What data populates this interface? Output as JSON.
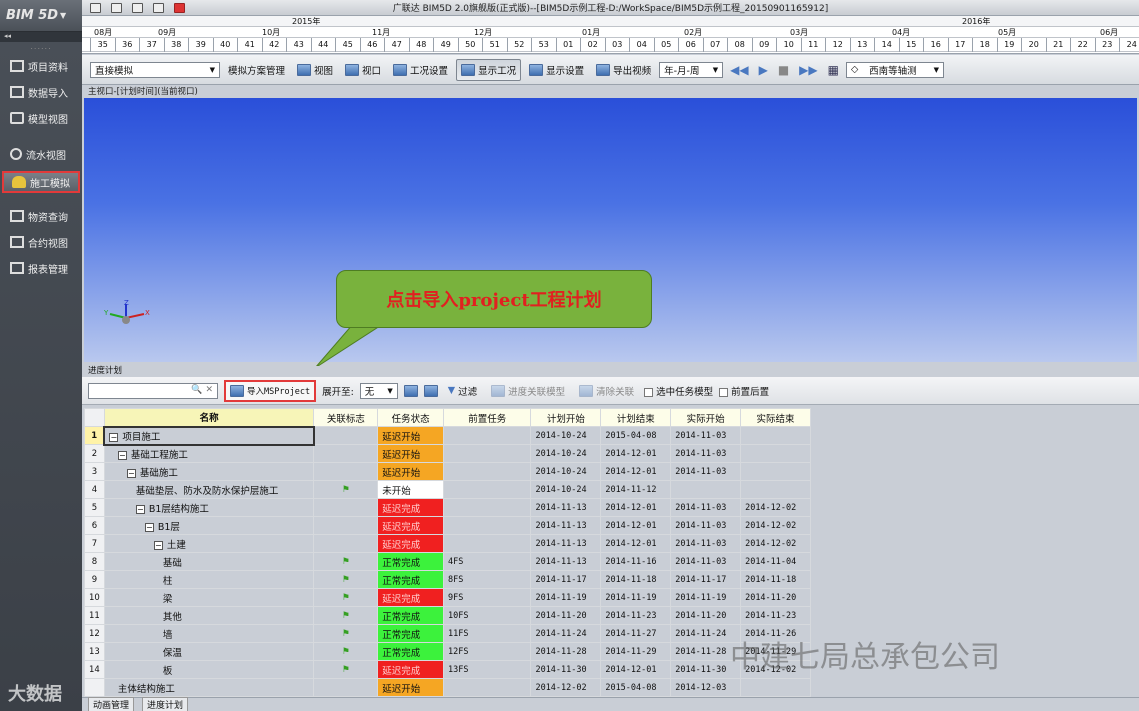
{
  "app": {
    "logo": "BIM 5D",
    "window_title": "广联达 BIM5D 2.0旗舰版(正式版)--[BIM5D示例工程-D:/WorkSpace/BIM5D示例工程_20150901165912]"
  },
  "sidebar": {
    "items": [
      {
        "label": "项目资料",
        "icon": "folder-icon"
      },
      {
        "label": "数据导入",
        "icon": "import-icon"
      },
      {
        "label": "模型视图",
        "icon": "model-icon"
      },
      {
        "label": "流水视图",
        "icon": "flow-icon"
      },
      {
        "label": "施工模拟",
        "icon": "worker-icon",
        "active": true
      },
      {
        "label": "物资查询",
        "icon": "material-icon"
      },
      {
        "label": "合约视图",
        "icon": "contract-icon"
      },
      {
        "label": "报表管理",
        "icon": "report-icon"
      }
    ]
  },
  "timeline": {
    "years": [
      "2015年",
      "2016年"
    ],
    "months": [
      "08月",
      "09月",
      "10月",
      "11月",
      "12月",
      "01月",
      "02月",
      "03月",
      "04月",
      "05月",
      "06月"
    ],
    "weeks": [
      "35",
      "36",
      "37",
      "38",
      "39",
      "40",
      "41",
      "42",
      "43",
      "44",
      "45",
      "46",
      "47",
      "48",
      "49",
      "50",
      "51",
      "52",
      "53",
      "01",
      "02",
      "03",
      "04",
      "05",
      "06",
      "07",
      "08",
      "09",
      "10",
      "11",
      "12",
      "13",
      "14",
      "15",
      "16",
      "17",
      "18",
      "19",
      "20",
      "21",
      "22",
      "23",
      "24"
    ]
  },
  "toolbar": {
    "mode_select": "直接模拟",
    "sim_plan": "模拟方案管理",
    "view": "视图",
    "viewport": "视口",
    "work_settings": "工况设置",
    "show_work": "显示工况",
    "display_settings": "显示设置",
    "export_video": "导出视频",
    "date_format": "年-月-周",
    "camera": "西南等轴测"
  },
  "viewport": {
    "caption": "主视口-[计划时间](当前视口)",
    "callout": "点击导入project工程计划"
  },
  "plan": {
    "caption": "进度计划",
    "import_button": "导入MSProject",
    "expand_label": "展开至:",
    "expand_value": "无",
    "filter": "过滤",
    "progress_model": "进度关联模型",
    "clear_link": "清除关联",
    "select_task_model": "选中任务模型",
    "pre_post": "前置后置",
    "columns": [
      "名称",
      "关联标志",
      "任务状态",
      "前置任务",
      "计划开始",
      "计划结束",
      "实际开始",
      "实际结束"
    ],
    "rows": [
      {
        "n": "1",
        "name": "项目施工",
        "tree": "−",
        "indent": 0,
        "flag": "",
        "status": "延迟开始",
        "st": "orange",
        "pre": "",
        "ps": "2014-10-24",
        "pe": "2015-04-08",
        "as": "2014-11-03",
        "ae": ""
      },
      {
        "n": "2",
        "name": "基础工程施工",
        "tree": "−",
        "indent": 1,
        "flag": "",
        "status": "延迟开始",
        "st": "orange",
        "pre": "",
        "ps": "2014-10-24",
        "pe": "2014-12-01",
        "as": "2014-11-03",
        "ae": ""
      },
      {
        "n": "3",
        "name": "基础施工",
        "tree": "−",
        "indent": 2,
        "flag": "",
        "status": "延迟开始",
        "st": "orange",
        "pre": "",
        "ps": "2014-10-24",
        "pe": "2014-12-01",
        "as": "2014-11-03",
        "ae": ""
      },
      {
        "n": "4",
        "name": "基础垫层、防水及防水保护层施工",
        "tree": "",
        "indent": 3,
        "flag": "⚑",
        "status": "未开始",
        "st": "white",
        "pre": "",
        "ps": "2014-10-24",
        "pe": "2014-11-12",
        "as": "",
        "ae": ""
      },
      {
        "n": "5",
        "name": "B1层结构施工",
        "tree": "−",
        "indent": 3,
        "flag": "",
        "status": "延迟完成",
        "st": "red",
        "pre": "",
        "ps": "2014-11-13",
        "pe": "2014-12-01",
        "as": "2014-11-03",
        "ae": "2014-12-02"
      },
      {
        "n": "6",
        "name": "B1层",
        "tree": "−",
        "indent": 4,
        "flag": "",
        "status": "延迟完成",
        "st": "red",
        "pre": "",
        "ps": "2014-11-13",
        "pe": "2014-12-01",
        "as": "2014-11-03",
        "ae": "2014-12-02"
      },
      {
        "n": "7",
        "name": "土建",
        "tree": "−",
        "indent": 5,
        "flag": "",
        "status": "延迟完成",
        "st": "red",
        "pre": "",
        "ps": "2014-11-13",
        "pe": "2014-12-01",
        "as": "2014-11-03",
        "ae": "2014-12-02"
      },
      {
        "n": "8",
        "name": "基础",
        "tree": "",
        "indent": 6,
        "flag": "⚑",
        "status": "正常完成",
        "st": "green",
        "pre": "4FS",
        "ps": "2014-11-13",
        "pe": "2014-11-16",
        "as": "2014-11-03",
        "ae": "2014-11-04"
      },
      {
        "n": "9",
        "name": "柱",
        "tree": "",
        "indent": 6,
        "flag": "⚑",
        "status": "正常完成",
        "st": "green",
        "pre": "8FS",
        "ps": "2014-11-17",
        "pe": "2014-11-18",
        "as": "2014-11-17",
        "ae": "2014-11-18"
      },
      {
        "n": "10",
        "name": "梁",
        "tree": "",
        "indent": 6,
        "flag": "⚑",
        "status": "延迟完成",
        "st": "red",
        "pre": "9FS",
        "ps": "2014-11-19",
        "pe": "2014-11-19",
        "as": "2014-11-19",
        "ae": "2014-11-20"
      },
      {
        "n": "11",
        "name": "其他",
        "tree": "",
        "indent": 6,
        "flag": "⚑",
        "status": "正常完成",
        "st": "green",
        "pre": "10FS",
        "ps": "2014-11-20",
        "pe": "2014-11-23",
        "as": "2014-11-20",
        "ae": "2014-11-23"
      },
      {
        "n": "12",
        "name": "墙",
        "tree": "",
        "indent": 6,
        "flag": "⚑",
        "status": "正常完成",
        "st": "green",
        "pre": "11FS",
        "ps": "2014-11-24",
        "pe": "2014-11-27",
        "as": "2014-11-24",
        "ae": "2014-11-26"
      },
      {
        "n": "13",
        "name": "保温",
        "tree": "",
        "indent": 6,
        "flag": "⚑",
        "status": "正常完成",
        "st": "green",
        "pre": "12FS",
        "ps": "2014-11-28",
        "pe": "2014-11-29",
        "as": "2014-11-28",
        "ae": "2014-11-29"
      },
      {
        "n": "14",
        "name": "板",
        "tree": "",
        "indent": 6,
        "flag": "⚑",
        "status": "延迟完成",
        "st": "red",
        "pre": "13FS",
        "ps": "2014-11-30",
        "pe": "2014-12-01",
        "as": "2014-11-30",
        "ae": "2014-12-02"
      },
      {
        "n": "",
        "name": "主体结构施工",
        "tree": "",
        "indent": 1,
        "flag": "",
        "status": "延迟开始",
        "st": "orange",
        "pre": "",
        "ps": "2014-12-02",
        "pe": "2015-04-08",
        "as": "2014-12-03",
        "ae": ""
      }
    ]
  },
  "statusbar": {
    "tab1": "动画管理",
    "tab2": "进度计划"
  },
  "watermark": {
    "main": "中建七局总承包公司",
    "corner": "大数据"
  },
  "colors": {
    "delay_start": "#f5a623",
    "delay_finish": "#f02020",
    "normal_finish": "#3cf23c",
    "highlight": "#e23a3a",
    "callout_bg": "#79b23d"
  }
}
